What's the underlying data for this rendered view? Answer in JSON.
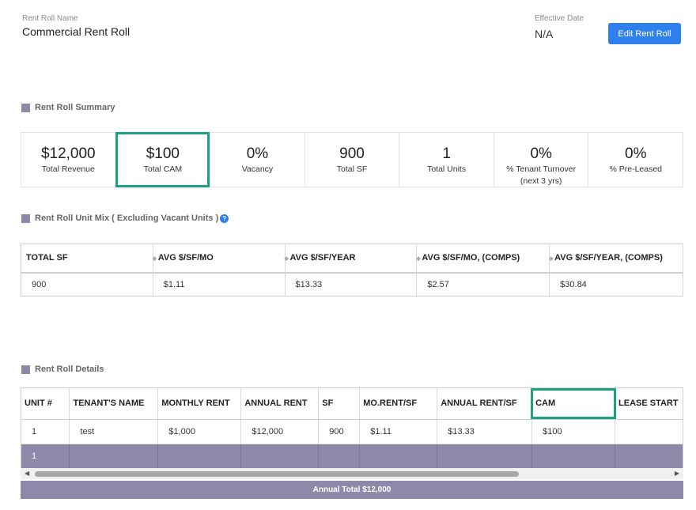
{
  "header": {
    "rent_roll_name_label": "Rent Roll Name",
    "rent_roll_name": "Commercial Rent Roll",
    "effective_date_label": "Effective Date",
    "effective_date": "N/A",
    "edit_button": "Edit Rent Roll"
  },
  "summary": {
    "title": "Rent Roll Summary",
    "cards": [
      {
        "value": "$12,000",
        "label": "Total Revenue"
      },
      {
        "value": "$100",
        "label": "Total CAM"
      },
      {
        "value": "0%",
        "label": "Vacancy"
      },
      {
        "value": "900",
        "label": "Total SF"
      },
      {
        "value": "1",
        "label": "Total Units"
      },
      {
        "value": "0%",
        "label": "% Tenant Turnover (next 3 yrs)"
      },
      {
        "value": "0%",
        "label": "% Pre-Leased"
      }
    ]
  },
  "unit_mix": {
    "title": "Rent Roll Unit Mix ( Excluding Vacant Units )",
    "help_icon": "?",
    "columns": [
      "TOTAL SF",
      "AVG $/SF/MO",
      "AVG $/SF/YEAR",
      "AVG $/SF/MO, (COMPS)",
      "AVG $/SF/YEAR, (COMPS)"
    ],
    "row": [
      "900",
      "$1.11",
      "$13.33",
      "$2.57",
      "$30.84"
    ]
  },
  "details": {
    "title": "Rent Roll Details",
    "columns": [
      "UNIT #",
      "TENANT'S NAME",
      "MONTHLY RENT",
      "ANNUAL RENT",
      "SF",
      "MO.RENT/SF",
      "ANNUAL RENT/SF",
      "CAM",
      "LEASE START"
    ],
    "row": [
      "1",
      "test",
      "$1,000",
      "$12,000",
      "900",
      "$1.11",
      "$13.33",
      "$100",
      ""
    ],
    "total_row": [
      "1",
      "",
      "",
      "",
      "",
      "",
      "",
      "",
      ""
    ],
    "annual_total": "Annual Total $12,000"
  },
  "colors": {
    "accent": "#2f80ed",
    "highlight": "#1fa084",
    "table_total": "#8c8aa8"
  }
}
